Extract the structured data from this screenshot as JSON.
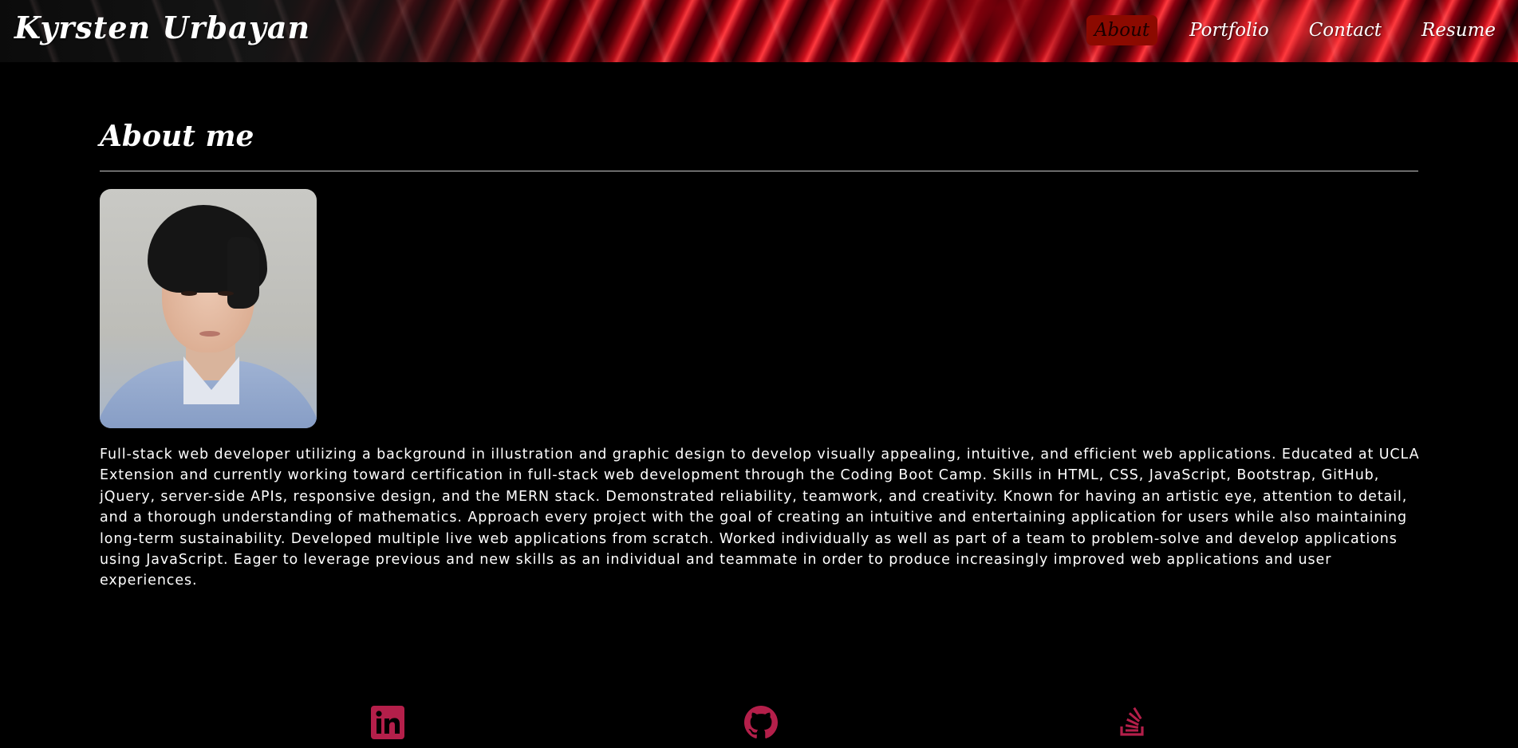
{
  "header": {
    "brand": "Kyrsten Urbayan",
    "nav": [
      {
        "label": "About",
        "active": true
      },
      {
        "label": "Portfolio",
        "active": false
      },
      {
        "label": "Contact",
        "active": false
      },
      {
        "label": "Resume",
        "active": false
      }
    ]
  },
  "about": {
    "title": "About me",
    "bio": "Full-stack web developer utilizing a background in illustration and graphic design to develop visually appealing, intuitive, and efficient web applications. Educated at UCLA Extension and currently working toward certification in full-stack web development through the Coding Boot Camp. Skills in HTML, CSS, JavaScript, Bootstrap, GitHub, jQuery, server-side APIs, responsive design, and the MERN stack. Demonstrated reliability, teamwork, and creativity. Known for having an artistic eye, attention to detail, and a thorough understanding of mathematics. Approach every project with the goal of creating an intuitive and entertaining application for users while also maintaining long-term sustainability. Developed multiple live web applications from scratch. Worked individually as well as part of a team to problem-solve and develop applications using JavaScript. Eager to leverage previous and new skills as an individual and teammate in order to produce increasingly improved web applications and user experiences."
  },
  "social": [
    {
      "icon": "linkedin-icon"
    },
    {
      "icon": "github-icon"
    },
    {
      "icon": "stack-overflow-icon"
    }
  ],
  "colors": {
    "accent": "#b41f4a",
    "nav_active_bg": "#8c0a00",
    "background": "#000000",
    "text": "#ffffff"
  }
}
